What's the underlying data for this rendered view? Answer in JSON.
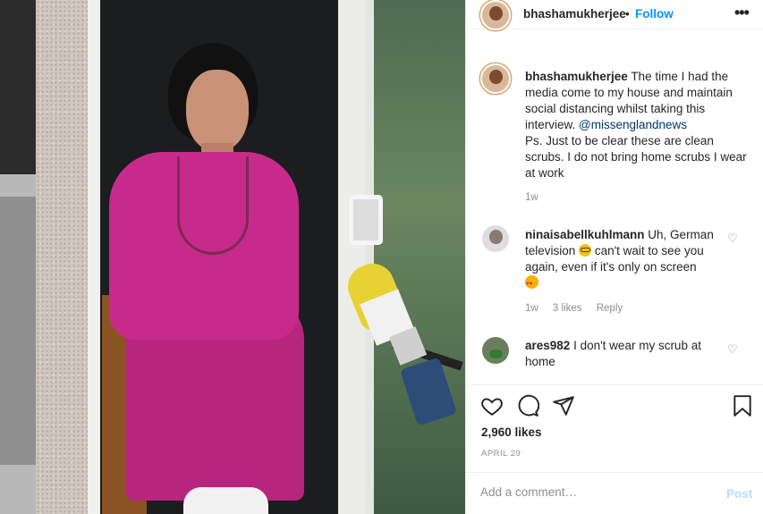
{
  "post": {
    "username": "bhashamukherjee",
    "separator": "•",
    "follow_label": "Follow",
    "more_icon": "more-horizontal-icon"
  },
  "caption": {
    "username": "bhashamukherjee",
    "text_1": "The time I had the media come to my house and maintain social distancing whilst taking this interview.",
    "mention": "@missenglandnews",
    "text_2": "Ps. Just to be clear these are clean scrubs. I do not bring home scrubs I wear at work",
    "time": "1w"
  },
  "comments": [
    {
      "username": "ninaisabellkuhlmann",
      "text_before": "Uh, German television",
      "text_after": "can't wait to see you again, even if it's only on screen",
      "time": "1w",
      "likes": "3 likes",
      "reply_label": "Reply"
    },
    {
      "username": "ares982",
      "text": "I don't wear my scrub at home"
    }
  ],
  "actions": {
    "like_icon": "heart-outline-icon",
    "comment_icon": "comment-bubble-icon",
    "share_icon": "paper-plane-icon",
    "save_icon": "bookmark-icon"
  },
  "likes_count": "2,960 likes",
  "post_date": "APRIL 29",
  "add_comment": {
    "placeholder": "Add a comment…",
    "post_label": "Post"
  },
  "colors": {
    "accent_blue": "#0095f6",
    "post_disabled": "#b3dffc",
    "mention_blue": "#00376b",
    "muted_gray": "#8e8e8e",
    "scrubs_pink": "#c72a8a"
  }
}
